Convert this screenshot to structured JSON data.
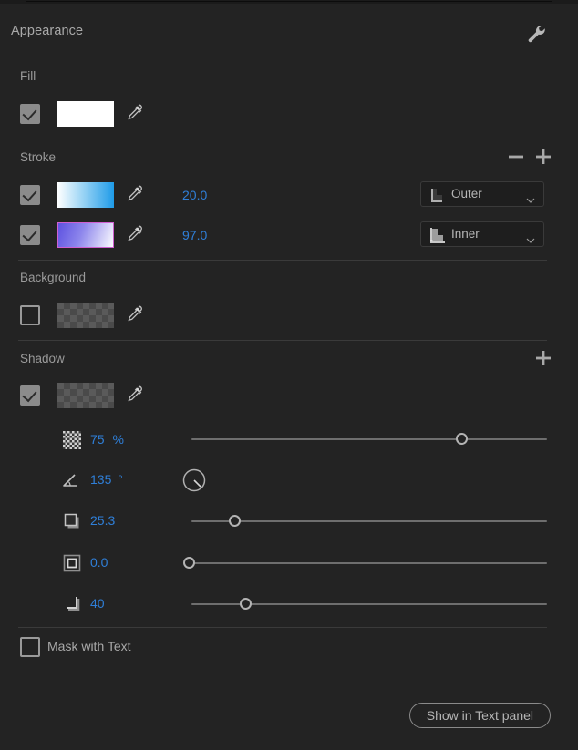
{
  "panel": {
    "title": "Appearance",
    "settings_icon": "wrench-icon"
  },
  "fill": {
    "label": "Fill",
    "enabled": true,
    "swatch_color": "#ffffff",
    "eyedropper_icon": "eyedropper-icon"
  },
  "stroke": {
    "label": "Stroke",
    "remove_label": "−",
    "add_label": "+",
    "items": [
      {
        "enabled": true,
        "gradient_from": "#ffffff",
        "gradient_to": "#1f9be8",
        "width": "20.0",
        "position": "Outer",
        "position_icon": "stroke-outer-icon"
      },
      {
        "enabled": true,
        "gradient_from": "#5b4fe0",
        "gradient_to": "#ffffff",
        "border_color": "#cf5fd0",
        "width": "97.0",
        "position": "Inner",
        "position_icon": "stroke-inner-icon"
      }
    ]
  },
  "background": {
    "label": "Background",
    "enabled": false,
    "swatch_type": "checkerboard"
  },
  "shadow": {
    "label": "Shadow",
    "add_label": "+",
    "enabled": true,
    "swatch_type": "checkerboard",
    "params": [
      {
        "icon": "opacity-checker-icon",
        "value": "75",
        "unit": "%",
        "control": "slider",
        "fraction": 0.762
      },
      {
        "icon": "angle-icon",
        "value": "135",
        "unit": "°",
        "control": "dial",
        "fraction": 0.375
      },
      {
        "icon": "distance-icon",
        "value": "25.3",
        "unit": "",
        "control": "slider",
        "fraction": 0.128
      },
      {
        "icon": "blur-icon",
        "value": "0.0",
        "unit": "",
        "control": "slider",
        "fraction": 0.0
      },
      {
        "icon": "spread-icon",
        "value": "40",
        "unit": "",
        "control": "slider",
        "fraction": 0.159
      }
    ]
  },
  "mask": {
    "label": "Mask with Text",
    "enabled": false
  },
  "footer": {
    "button_label": "Show in Text panel"
  },
  "colors": {
    "panel_bg": "#232323",
    "accent_blue": "#2f7fd8",
    "label_gray": "#9a9a9a",
    "divider": "#3a3a3a"
  }
}
